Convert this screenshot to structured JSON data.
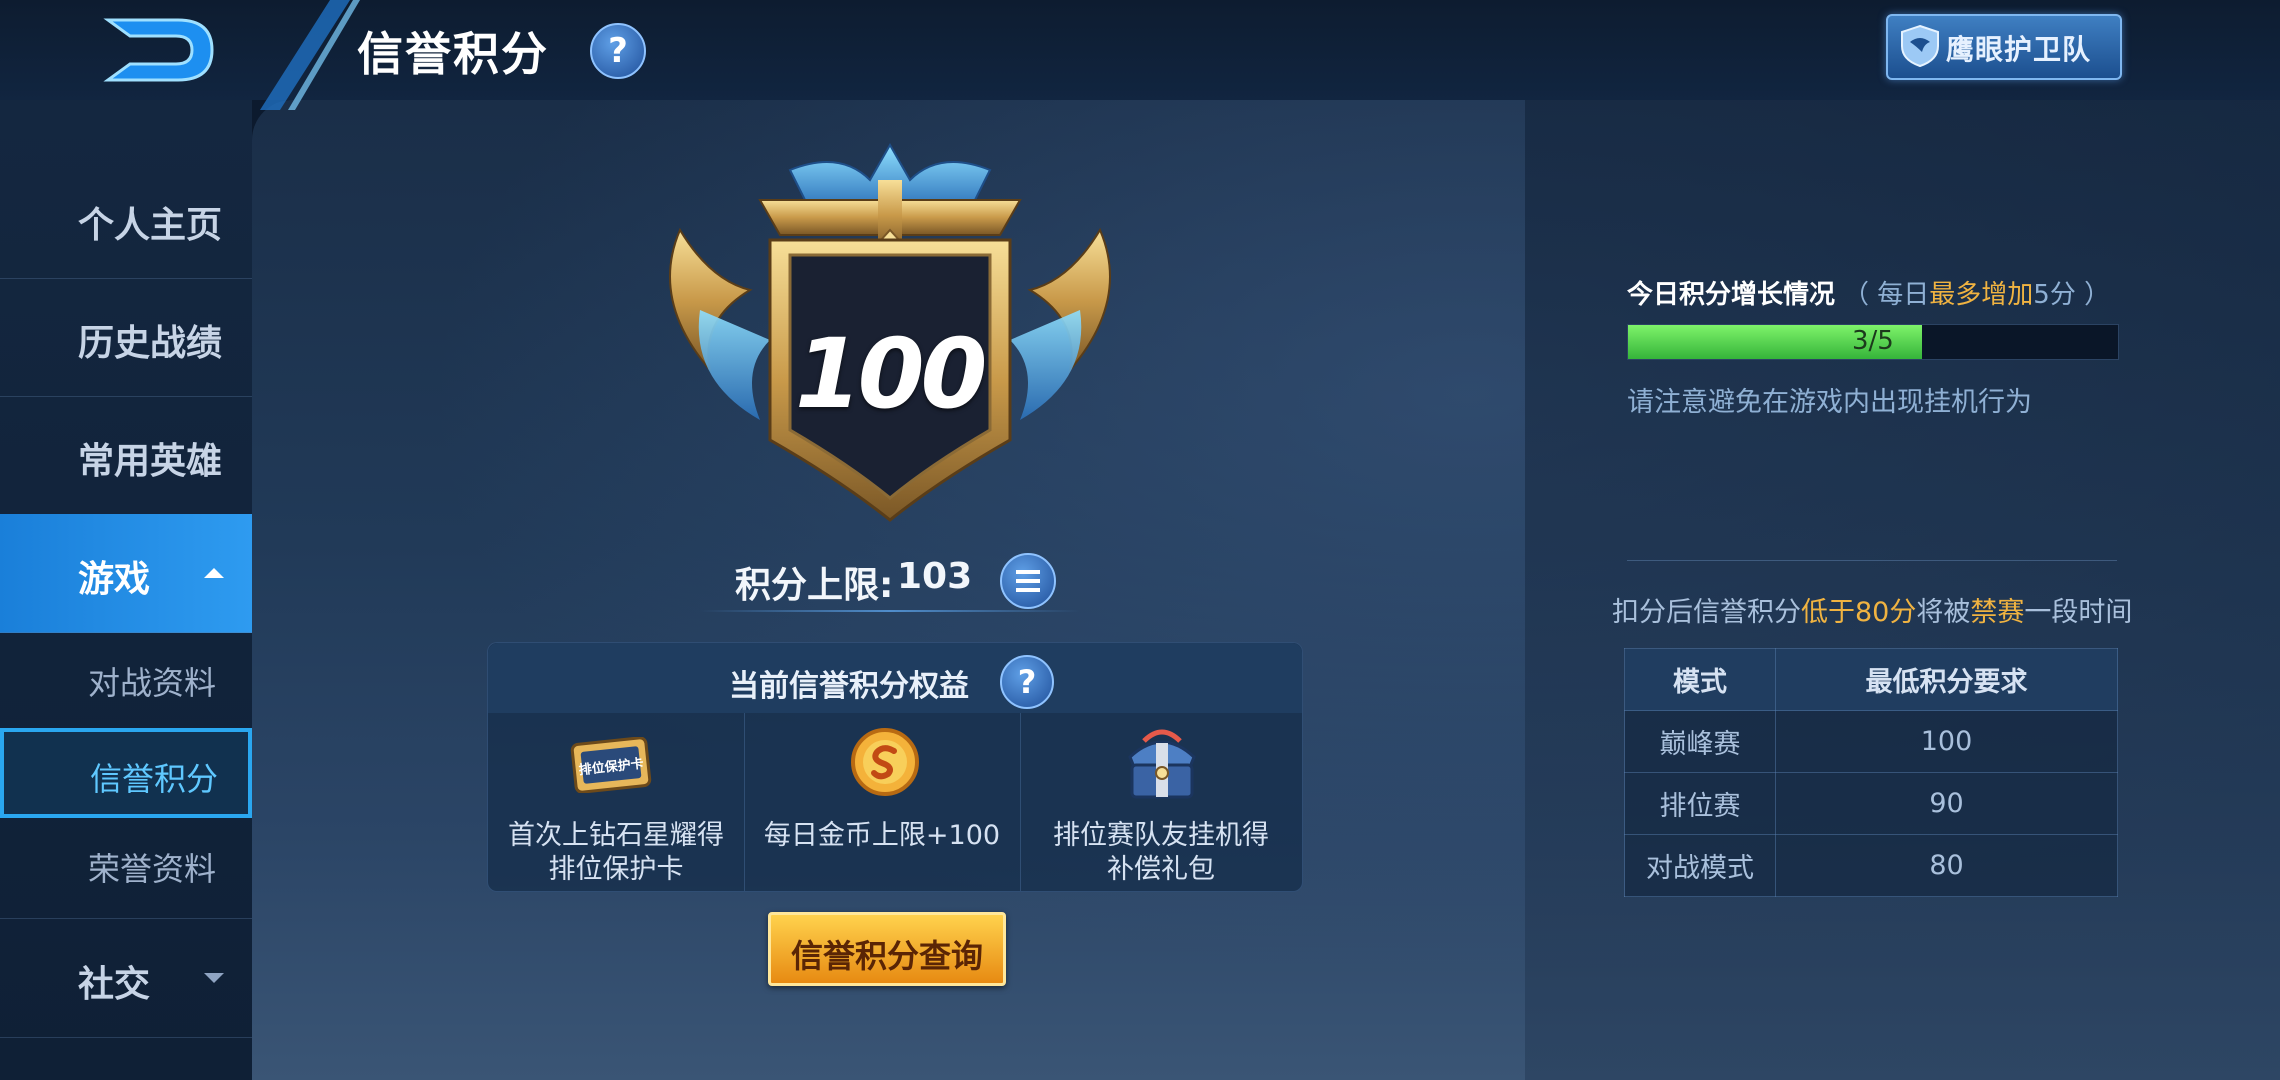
{
  "header": {
    "title": "信誉积分",
    "help_symbol": "?",
    "eagle_button_label": "鹰眼护卫队"
  },
  "sidebar": {
    "items": [
      {
        "label": "个人主页"
      },
      {
        "label": "历史战绩"
      },
      {
        "label": "常用英雄"
      },
      {
        "label": "游戏",
        "expanded": true
      },
      {
        "label": "社交",
        "expanded": false
      }
    ],
    "sub_items": [
      {
        "label": "对战资料"
      },
      {
        "label": "信誉积分",
        "selected": true
      },
      {
        "label": "荣誉资料"
      }
    ]
  },
  "credit": {
    "score": "100",
    "limit_label": "积分上限:",
    "limit_value": "103"
  },
  "benefits": {
    "title": "当前信誉积分权益",
    "items": [
      {
        "icon": "rank-protect-card-icon",
        "icon_text": "排位保护卡",
        "line1": "首次上钻石星耀得",
        "line2": "排位保护卡"
      },
      {
        "icon": "gold-coin-icon",
        "line1": "每日金币上限+100",
        "line2": ""
      },
      {
        "icon": "gift-chest-icon",
        "line1": "排位赛队友挂机得",
        "line2": "补偿礼包"
      }
    ]
  },
  "query_button": "信誉积分查询",
  "daily": {
    "title": "今日积分增长情况",
    "sub_open": "（ 每日",
    "sub_highlight": "最多增加",
    "sub_close": "5分 ）",
    "progress_current": 3,
    "progress_max": 5,
    "progress_text": "3/5",
    "warning": "请注意避免在游戏内出现挂机行为"
  },
  "ban_notice": {
    "part1": "扣分后信誉积分",
    "hl1": "低于80分",
    "part2": "将被",
    "hl2": "禁赛",
    "part3": "一段时间"
  },
  "requirements": {
    "headers": [
      "模式",
      "最低积分要求"
    ],
    "rows": [
      [
        "巅峰赛",
        "100"
      ],
      [
        "排位赛",
        "90"
      ],
      [
        "对战模式",
        "80"
      ]
    ]
  },
  "colors": {
    "accent_blue": "#2aa7f0",
    "highlight_orange": "#f0b341",
    "progress_green": "#5fd94f",
    "button_gold": "#f5a623"
  }
}
